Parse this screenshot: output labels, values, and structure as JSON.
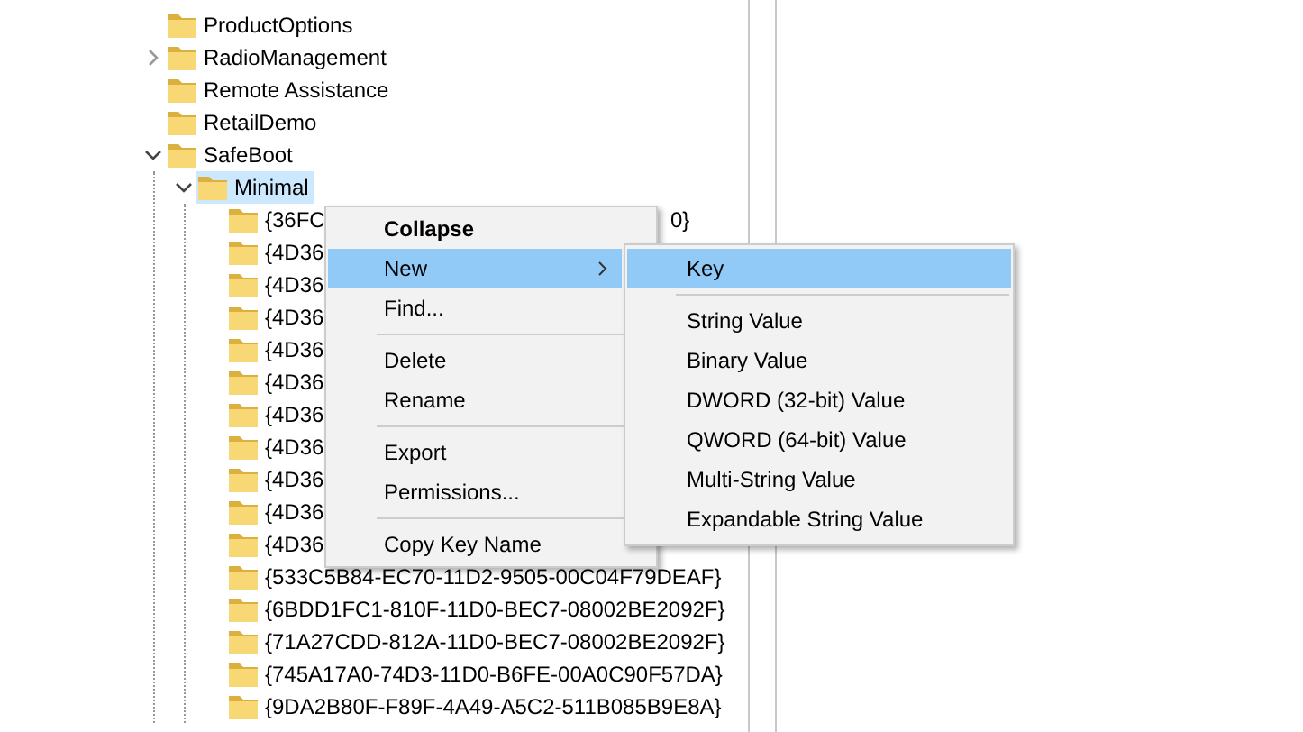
{
  "tree": [
    {
      "label": "ProductOptions",
      "selected": false
    },
    {
      "label": "RadioManagement",
      "selected": false,
      "expanded": false
    },
    {
      "label": "Remote Assistance",
      "selected": false
    },
    {
      "label": "RetailDemo",
      "selected": false
    },
    {
      "label": "SafeBoot",
      "selected": false,
      "expanded": true,
      "children": [
        {
          "label": "Minimal",
          "selected": true,
          "expanded": true,
          "children": [
            {
              "label": "{36FC",
              "tail": "0}",
              "selected": false
            },
            {
              "label": "{4D36",
              "selected": false
            },
            {
              "label": "{4D36",
              "selected": false
            },
            {
              "label": "{4D36",
              "selected": false
            },
            {
              "label": "{4D36",
              "selected": false
            },
            {
              "label": "{4D36",
              "selected": false
            },
            {
              "label": "{4D36",
              "selected": false
            },
            {
              "label": "{4D36",
              "selected": false
            },
            {
              "label": "{4D36",
              "selected": false
            },
            {
              "label": "{4D36",
              "selected": false
            },
            {
              "label": "{4D36",
              "selected": false
            },
            {
              "label": "{533C5B84-EC70-11D2-9505-00C04F79DEAF}",
              "selected": false
            },
            {
              "label": "{6BDD1FC1-810F-11D0-BEC7-08002BE2092F}",
              "selected": false
            },
            {
              "label": "{71A27CDD-812A-11D0-BEC7-08002BE2092F}",
              "selected": false
            },
            {
              "label": "{745A17A0-74D3-11D0-B6FE-00A0C90F57DA}",
              "selected": false
            },
            {
              "label": "{9DA2B80F-F89F-4A49-A5C2-511B085B9E8A}",
              "selected": false
            }
          ]
        }
      ]
    }
  ],
  "context_menu": [
    {
      "kind": "item",
      "label": "Collapse",
      "default": true,
      "selected": false
    },
    {
      "kind": "item",
      "label": "New",
      "submenu": true,
      "selected": true
    },
    {
      "kind": "item",
      "label": "Find...",
      "selected": false
    },
    {
      "kind": "separator"
    },
    {
      "kind": "item",
      "label": "Delete",
      "selected": false
    },
    {
      "kind": "item",
      "label": "Rename",
      "selected": false
    },
    {
      "kind": "separator"
    },
    {
      "kind": "item",
      "label": "Export",
      "selected": false
    },
    {
      "kind": "item",
      "label": "Permissions...",
      "selected": false
    },
    {
      "kind": "separator"
    },
    {
      "kind": "item",
      "label": "Copy Key Name",
      "selected": false
    }
  ],
  "submenu": [
    {
      "kind": "item",
      "label": "Key",
      "selected": true
    },
    {
      "kind": "separator"
    },
    {
      "kind": "item",
      "label": "String Value",
      "selected": false
    },
    {
      "kind": "item",
      "label": "Binary Value",
      "selected": false
    },
    {
      "kind": "item",
      "label": "DWORD (32-bit) Value",
      "selected": false
    },
    {
      "kind": "item",
      "label": "QWORD (64-bit) Value",
      "selected": false
    },
    {
      "kind": "item",
      "label": "Multi-String Value",
      "selected": false
    },
    {
      "kind": "item",
      "label": "Expandable String Value",
      "selected": false
    }
  ]
}
